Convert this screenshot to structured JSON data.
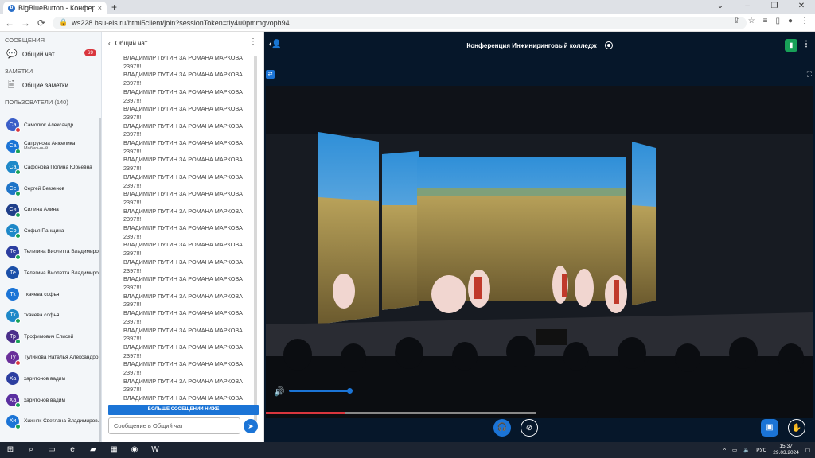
{
  "browser": {
    "tab_title": "BigBlueButton - Конферен",
    "tab_close": "×",
    "new_tab": "+",
    "url": "ws228.bsu-eis.ru/html5client/join?sessionToken=tiy4u0pmmgvoph94",
    "win_controls": [
      "⌄",
      "–",
      "❐",
      "✕"
    ]
  },
  "left_panel": {
    "messages_heading": "СООБЩЕНИЯ",
    "public_chat_label": "Общий чат",
    "public_chat_badge": "69",
    "notes_heading": "ЗАМЕТКИ",
    "shared_notes_label": "Общие заметки",
    "users_heading": "ПОЛЬЗОВАТЕЛИ (140)",
    "users": [
      {
        "initials": "Са",
        "name": "Самолюк Александр",
        "sub": "",
        "color": "#3a5ec8",
        "status": "#d9363e"
      },
      {
        "initials": "Са",
        "name": "Сапрунова Анжелика",
        "sub": "Мобильный",
        "color": "#1b74d6",
        "status": "#18a058"
      },
      {
        "initials": "Са",
        "name": "Сафонова Полина Юрьевна",
        "sub": "",
        "color": "#1e88c8",
        "status": "#18a058"
      },
      {
        "initials": "Се",
        "name": "Сергей Беззенов",
        "sub": "",
        "color": "#1e74c8",
        "status": "#18a058"
      },
      {
        "initials": "Си",
        "name": "Силина Алина",
        "sub": "",
        "color": "#1f3f8a",
        "status": "#18a058"
      },
      {
        "initials": "Со",
        "name": "Софья Панщина",
        "sub": "",
        "color": "#1e88c8",
        "status": "#18a058"
      },
      {
        "initials": "Те",
        "name": "Телегина Виолетта Владимиро...",
        "sub": "",
        "color": "#2c3ea0",
        "status": "#18a058"
      },
      {
        "initials": "Те",
        "name": "Телегина Виолетта Владимиро...",
        "sub": "",
        "color": "#1b4fa8",
        "status": ""
      },
      {
        "initials": "Тк",
        "name": "ткачева софья",
        "sub": "",
        "color": "#1b74d6",
        "status": ""
      },
      {
        "initials": "Тк",
        "name": "ткачева софья",
        "sub": "",
        "color": "#1e88c8",
        "status": "#18a058"
      },
      {
        "initials": "Тр",
        "name": "Трофимович Елисей",
        "sub": "",
        "color": "#4a2f8a",
        "status": "#18a058"
      },
      {
        "initials": "Ту",
        "name": "Тулинова Наталья Александро...",
        "sub": "",
        "color": "#6a2f9a",
        "status": "#d9363e"
      },
      {
        "initials": "Ха",
        "name": "харитонов вадим",
        "sub": "",
        "color": "#2c3ea0",
        "status": ""
      },
      {
        "initials": "Ха",
        "name": "харитонов вадим",
        "sub": "",
        "color": "#5a2fa0",
        "status": "#18a058"
      },
      {
        "initials": "Хи",
        "name": "Хижняк Светлана Владимиров...",
        "sub": "",
        "color": "#1b74d6",
        "status": "#18a058"
      }
    ]
  },
  "chat": {
    "title": "Общий чат",
    "messages": [
      "ВЛАДИМИР ПУТИН ЗА РОМАНА МАРКОВА",
      "2397!!!",
      "ВЛАДИМИР ПУТИН ЗА РОМАНА МАРКОВА",
      "2397!!!",
      "ВЛАДИМИР ПУТИН ЗА РОМАНА МАРКОВА",
      "2397!!!",
      "ВЛАДИМИР ПУТИН ЗА РОМАНА МАРКОВА",
      "2397!!!",
      "ВЛАДИМИР ПУТИН ЗА РОМАНА МАРКОВА",
      "2397!!!",
      "ВЛАДИМИР ПУТИН ЗА РОМАНА МАРКОВА",
      "2397!!!",
      "ВЛАДИМИР ПУТИН ЗА РОМАНА МАРКОВА",
      "2397!!!",
      "ВЛАДИМИР ПУТИН ЗА РОМАНА МАРКОВА",
      "2397!!!",
      "ВЛАДИМИР ПУТИН ЗА РОМАНА МАРКОВА",
      "2397!!!",
      "ВЛАДИМИР ПУТИН ЗА РОМАНА МАРКОВА",
      "2397!!!",
      "ВЛАДИМИР ПУТИН ЗА РОМАНА МАРКОВА",
      "2397!!!",
      "ВЛАДИМИР ПУТИН ЗА РОМАНА МАРКОВА",
      "2397!!!",
      "ВЛАДИМИР ПУТИН ЗА РОМАНА МАРКОВА",
      "2397!!!",
      "ВЛАДИМИР ПУТИН ЗА РОМАНА МАРКОВА",
      "2397!!!",
      "ВЛАДИМИР ПУТИН ЗА РОМАНА МАРКОВА",
      "2397!!!",
      "ВЛАДИМИР ПУТИН ЗА РОМАНА МАРКОВА",
      "2397!!!",
      "ВЛАДИМИР ПУТИН ЗА РОМАНА МАРКОВА",
      "2397!!!",
      "ВЛАДИМИР ПУТИН ЗА РОМАНА МАРКОВА",
      "2397!!!",
      "ВЛАДИМИР ПУТИН ЗА РОМАНА МАРКОВА",
      "2397!!!",
      "ВЛАДИМИР ПУТИН ЗА РОМАНА МАРКОВА",
      "2397!!!",
      "ВЛАДИМИР ПУТИН ЗА РОМАНА МАРКОВА"
    ],
    "more_messages_label": "БОЛЬШЕ СООБЩЕНИЙ НИЖЕ",
    "input_placeholder": "Сообщение в Общий чат"
  },
  "main": {
    "meeting_title": "Конференция Инжиниринговый колледж"
  },
  "taskbar": {
    "lang": "РУС",
    "time": "15:37",
    "date": "29.03.2024"
  }
}
